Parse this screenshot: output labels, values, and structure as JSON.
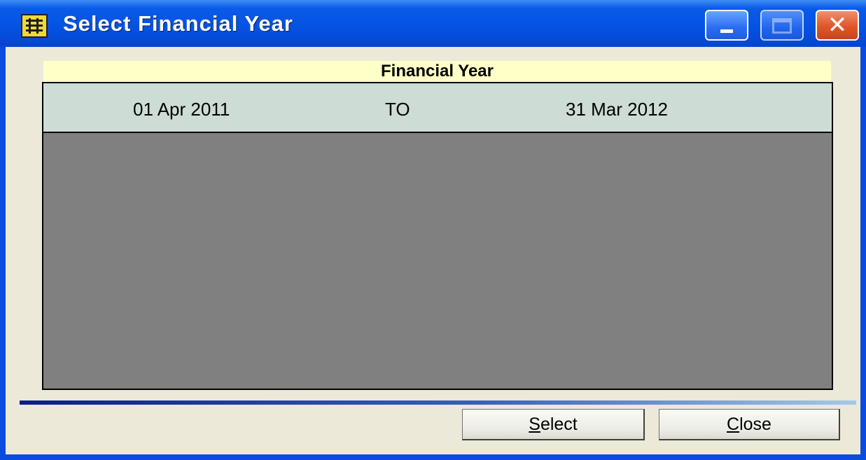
{
  "window": {
    "title": "Select Financial Year",
    "icon": "ledger-icon",
    "controls": {
      "minimize_icon": "minimize-icon",
      "maximize_icon": "maximize-icon",
      "close_icon": "close-icon",
      "close_glyph": "✕"
    }
  },
  "grid": {
    "header": "Financial Year",
    "rows": [
      {
        "from": "01 Apr 2011",
        "separator": "TO",
        "to": "31 Mar 2012"
      }
    ]
  },
  "buttons": {
    "select": {
      "mnemonic": "S",
      "rest": "elect"
    },
    "close": {
      "mnemonic": "C",
      "rest": "lose"
    }
  },
  "colors": {
    "titlebar": "#0553e3",
    "client_bg": "#ece9d8",
    "header_band": "#ffffc8",
    "row_bg": "#cddcd4",
    "grid_empty": "#808080"
  }
}
